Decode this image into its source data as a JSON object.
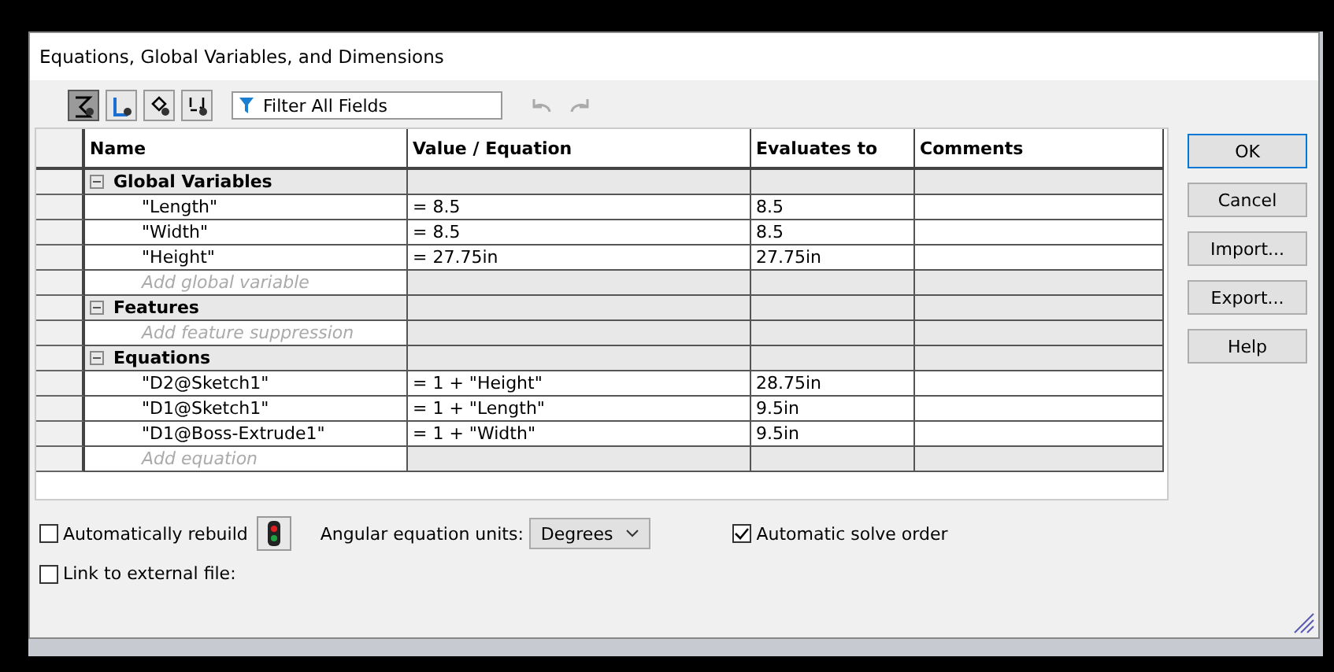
{
  "window": {
    "title": "Equations, Global Variables, and Dimensions"
  },
  "toolbar": {
    "views": [
      {
        "selected": true
      },
      {
        "selected": false
      },
      {
        "selected": false
      },
      {
        "selected": false
      }
    ],
    "filter": {
      "placeholder": "Filter All Fields"
    }
  },
  "table": {
    "columns": [
      "Name",
      "Value / Equation",
      "Evaluates to",
      "Comments"
    ],
    "rows": [
      {
        "kind": "group",
        "name": "Global Variables",
        "expanded": true
      },
      {
        "kind": "item",
        "name": "\"Length\"",
        "value": "= 8.5",
        "result": "8.5"
      },
      {
        "kind": "item",
        "name": "\"Width\"",
        "value": "= 8.5",
        "result": "8.5"
      },
      {
        "kind": "item",
        "name": "\"Height\"",
        "value": "= 27.75in",
        "result": "27.75in"
      },
      {
        "kind": "add",
        "name": "Add global variable"
      },
      {
        "kind": "group",
        "name": "Features",
        "expanded": true
      },
      {
        "kind": "add",
        "name": "Add feature suppression"
      },
      {
        "kind": "group",
        "name": "Equations",
        "expanded": true
      },
      {
        "kind": "item",
        "name": "\"D2@Sketch1\"",
        "value": "= 1 + \"Height\"",
        "result": "28.75in"
      },
      {
        "kind": "item",
        "name": "\"D1@Sketch1\"",
        "value": "= 1 + \"Length\"",
        "result": "9.5in"
      },
      {
        "kind": "item",
        "name": "\"D1@Boss-Extrude1\"",
        "value": "= 1 + \"Width\"",
        "result": "9.5in"
      },
      {
        "kind": "add",
        "name": "Add equation"
      }
    ]
  },
  "buttons": [
    {
      "label": "OK",
      "default": true
    },
    {
      "label": "Cancel",
      "default": false
    },
    {
      "label": "Import...",
      "default": false
    },
    {
      "label": "Export...",
      "default": false
    },
    {
      "label": "Help",
      "default": false
    }
  ],
  "options": {
    "auto_rebuild": {
      "label": "Automatically rebuild",
      "checked": false
    },
    "angular_units": {
      "label": "Angular equation units:",
      "value": "Degrees"
    },
    "auto_solve": {
      "label": "Automatic solve order",
      "checked": true
    },
    "link_file": {
      "label": "Link to external file:",
      "checked": false
    }
  }
}
